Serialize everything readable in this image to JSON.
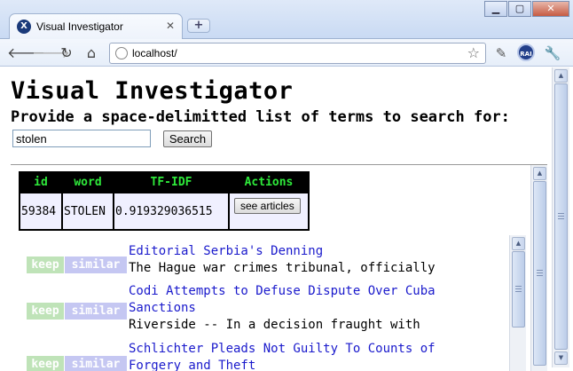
{
  "browser": {
    "tab_title": "Visual Investigator",
    "tab_favicon": "X",
    "url": "localhost/",
    "new_tab_label": "+",
    "window_minimize": "▁",
    "window_maximize": "▢",
    "window_close": "✕",
    "extension_badge": "RAI",
    "icons": [
      "back-arrow-icon",
      "forward-arrow-icon",
      "reload-icon",
      "home-icon",
      "globe-icon",
      "star-icon",
      "eyedropper-icon",
      "wrench-icon"
    ]
  },
  "page": {
    "title": "Visual Investigator",
    "prompt": "Provide a space-delimitted list of terms to search for:",
    "search": {
      "value": "stolen",
      "button_label": "Search"
    }
  },
  "results_table": {
    "headers": [
      "id",
      "word",
      "TF-IDF",
      "Actions"
    ],
    "rows": [
      {
        "id": "59384",
        "word": "STOLEN",
        "tfidf": "0.919329036515",
        "action_label": "see articles"
      }
    ]
  },
  "articles": [
    {
      "keep_label": "keep",
      "similar_label": "similar",
      "title_lines": [
        "Editorial Serbia's Denning"
      ],
      "snippet": "The Hague war crimes tribunal, officially"
    },
    {
      "keep_label": "keep",
      "similar_label": "similar",
      "title_lines": [
        "Codi Attempts to Defuse Dispute Over Cuba",
        "Sanctions"
      ],
      "snippet": "Riverside -- In a decision fraught with"
    },
    {
      "keep_label": "keep",
      "similar_label": "similar",
      "title_lines": [
        "Schlichter Pleads Not Guilty To Counts of",
        "Forgery and Theft"
      ],
      "snippet": ""
    }
  ],
  "colors": {
    "header_bg": "#000000",
    "header_text": "#2ee83a",
    "cell_bg": "#f0f0ff",
    "keep_tag": "#bfe3b8",
    "similar_tag": "#c5c7f2",
    "link": "#1a1acc"
  }
}
